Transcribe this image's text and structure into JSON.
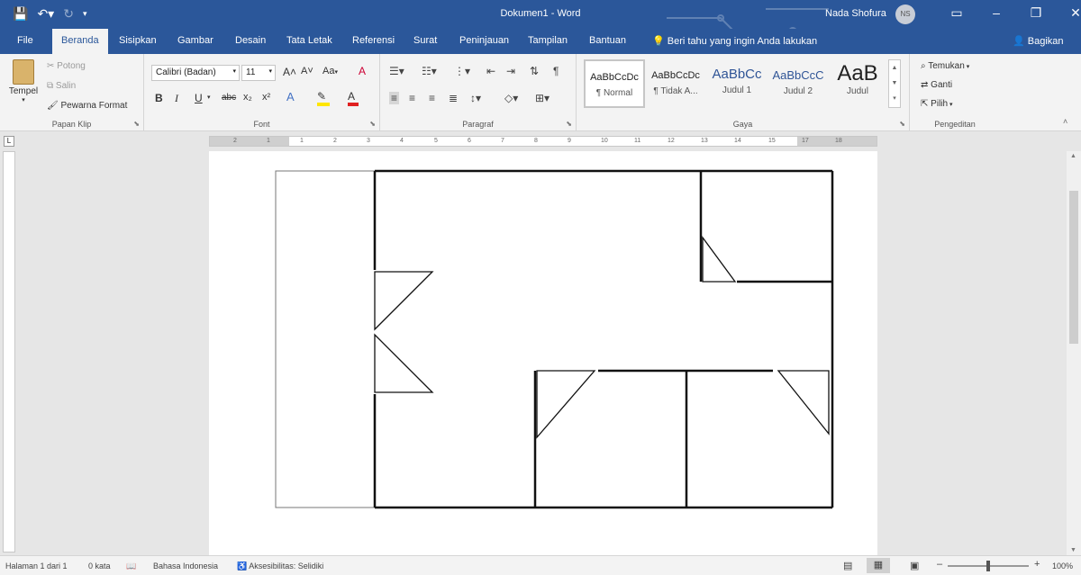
{
  "titlebar": {
    "doc_title": "Dokumen1  -  Word",
    "user_name": "Nada Shofura",
    "avatar_initials": "NS"
  },
  "tabs": {
    "file": "File",
    "beranda": "Beranda",
    "sisipkan": "Sisipkan",
    "gambar": "Gambar",
    "desain": "Desain",
    "tata_letak": "Tata Letak",
    "referensi": "Referensi",
    "surat": "Surat",
    "peninjauan": "Peninjauan",
    "tampilan": "Tampilan",
    "bantuan": "Bantuan",
    "tell_me": "Beri tahu yang ingin Anda lakukan",
    "share": "Bagikan"
  },
  "clipboard": {
    "paste": "Tempel",
    "cut": "Potong",
    "copy": "Salin",
    "format_painter": "Pewarna Format",
    "label": "Papan Klip"
  },
  "font": {
    "family": "Calibri (Badan)",
    "size": "11",
    "label": "Font",
    "bold": "B",
    "italic": "I",
    "underline": "U",
    "strike": "abc",
    "subscript": "x₂",
    "superscript": "x²",
    "grow": "A˄",
    "shrink": "A˅",
    "case": "Aa",
    "clear": "A"
  },
  "paragraph": {
    "label": "Paragraf"
  },
  "styles": {
    "label": "Gaya",
    "items": [
      {
        "preview": "AaBbCcDc",
        "name": "¶ Normal"
      },
      {
        "preview": "AaBbCcDc",
        "name": "¶ Tidak A..."
      },
      {
        "preview": "AaBbCc",
        "name": "Judul 1"
      },
      {
        "preview": "AaBbCcC",
        "name": "Judul 2"
      },
      {
        "preview": "AaB",
        "name": "Judul"
      }
    ]
  },
  "editing": {
    "find": "Temukan",
    "replace": "Ganti",
    "select": "Pilih",
    "label": "Pengeditan"
  },
  "ruler": {
    "top_labels": [
      "2",
      "1",
      "1",
      "2",
      "3",
      "4",
      "5",
      "6",
      "7",
      "8",
      "9",
      "10",
      "11",
      "12",
      "13",
      "14",
      "15",
      "17",
      "18"
    ]
  },
  "status": {
    "page": "Halaman 1 dari 1",
    "words": "0 kata",
    "language": "Bahasa Indonesia",
    "accessibility": "Aksesibilitas: Selidiki",
    "zoom": "100%"
  },
  "colors": {
    "titlebar": "#2b579a",
    "ribbon": "#f3f3f3",
    "highlight_yellow": "#ffe600",
    "font_red": "#e02020"
  }
}
